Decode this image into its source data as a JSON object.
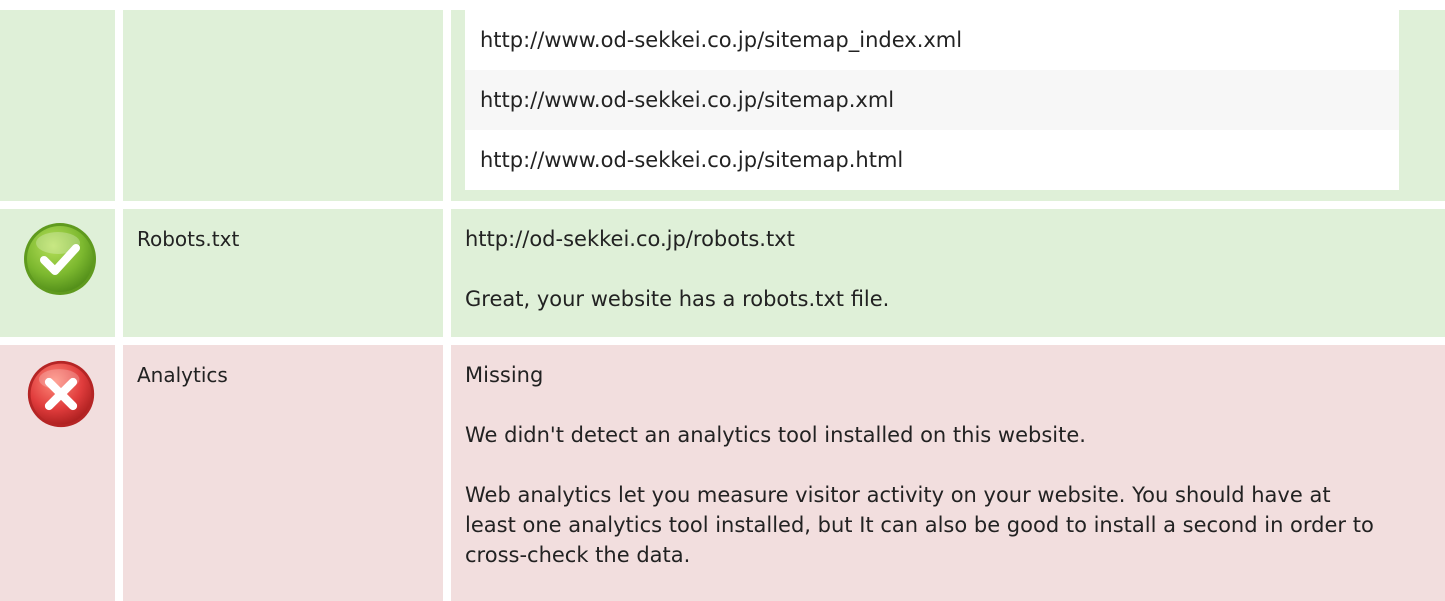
{
  "sitemaps": {
    "urls": [
      "http://www.od-sekkei.co.jp/sitemap_index.xml",
      "http://www.od-sekkei.co.jp/sitemap.xml",
      "http://www.od-sekkei.co.jp/sitemap.html"
    ]
  },
  "robots": {
    "status_icon": "check-icon",
    "label": "Robots.txt",
    "url": "http://od-sekkei.co.jp/robots.txt",
    "message": "Great, your website has a robots.txt file."
  },
  "analytics": {
    "status_icon": "error-icon",
    "label": "Analytics",
    "status": "Missing",
    "message": "We didn't detect an analytics tool installed on this website.",
    "advice": "Web analytics let you measure visitor activity on your website. You should have at least one analytics tool installed, but It can also be good to install a second in order to cross-check the data."
  },
  "colors": {
    "success_bg": "#dff0d8",
    "error_bg": "#f2dede",
    "success_icon": "#7cb82f",
    "error_icon": "#e03c3c"
  }
}
